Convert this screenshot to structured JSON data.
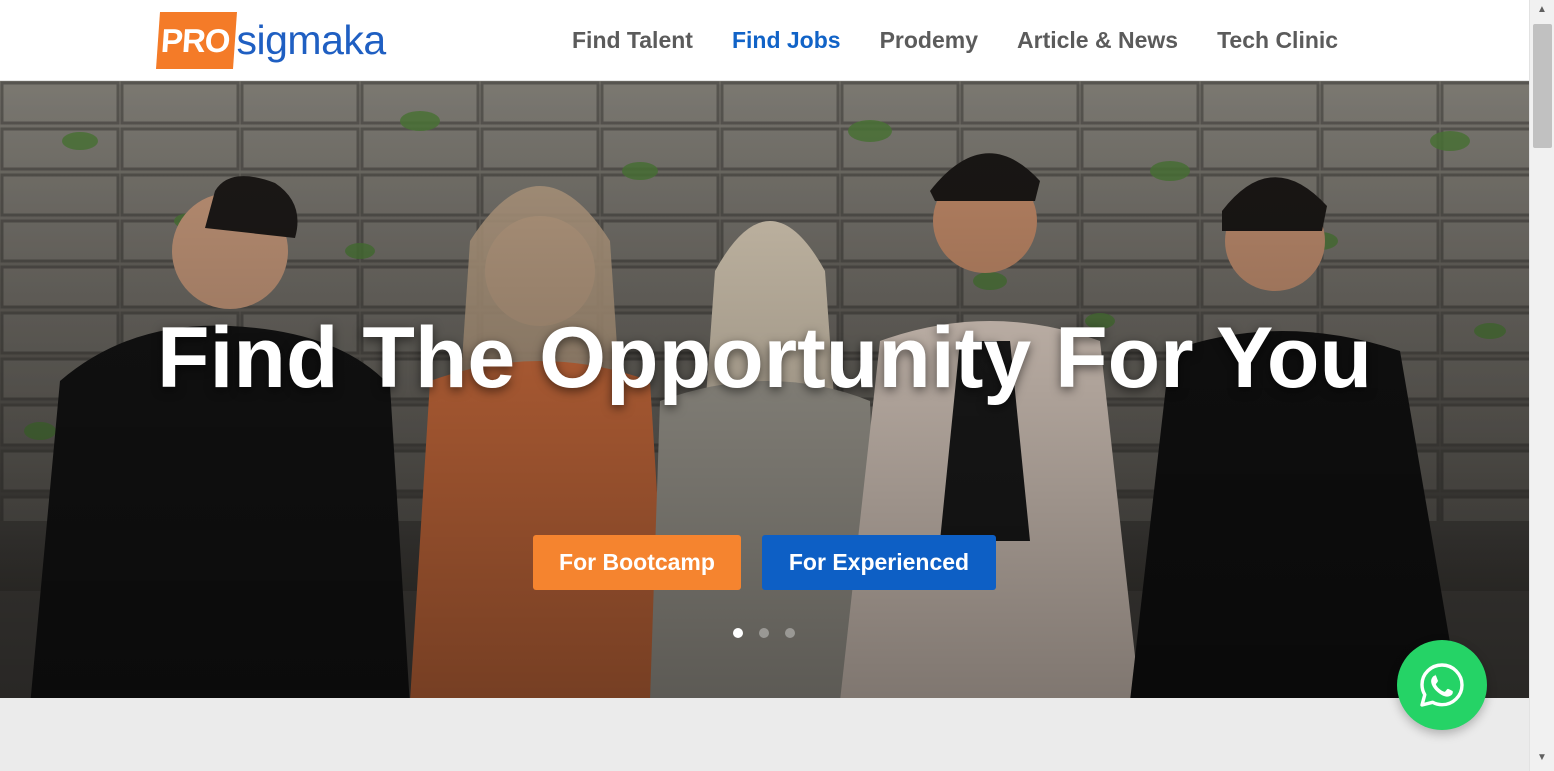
{
  "header": {
    "logo_pro": "PRO",
    "logo_rest": "sigmaka",
    "nav": [
      {
        "label": "Find Talent"
      },
      {
        "label": "Find Jobs"
      },
      {
        "label": "Prodemy"
      },
      {
        "label": "Article & News"
      },
      {
        "label": "Tech Clinic"
      }
    ]
  },
  "hero": {
    "title": "Find The Opportunity For You",
    "buttons": {
      "bootcamp": "For Bootcamp",
      "experienced": "For Experienced"
    },
    "slides_total": 3,
    "active_slide": 1
  },
  "colors": {
    "brand_orange": "#f5842f",
    "brand_blue": "#0d5fc5",
    "nav_active": "#1163c7",
    "whatsapp": "#25d366"
  },
  "icons": {
    "whatsapp": "whatsapp-icon"
  }
}
